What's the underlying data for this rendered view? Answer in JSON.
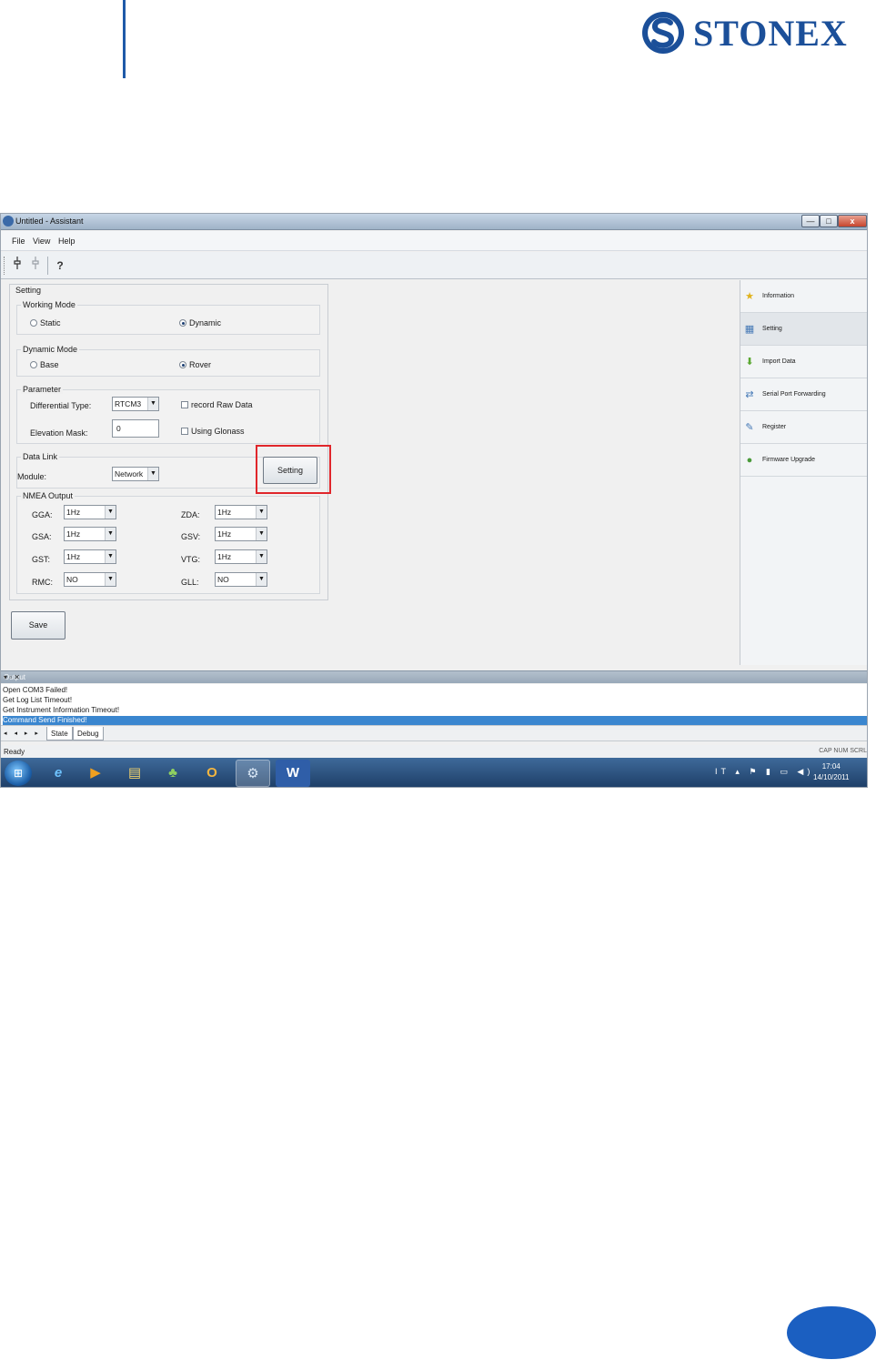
{
  "brand": {
    "name": "STONEX",
    "color": "#1b4f99"
  },
  "window": {
    "title": "Untitled - Assistant",
    "min_label": "—",
    "max_label": "□",
    "close_label": "x"
  },
  "menu": [
    "File",
    "View",
    "Help"
  ],
  "toolbar": {
    "icons": [
      "connect-icon",
      "disconnect-icon",
      "help-icon"
    ],
    "help_glyph": "?"
  },
  "setting": {
    "title": "Setting",
    "working_mode": {
      "label": "Working Mode",
      "options": [
        "Static",
        "Dynamic"
      ],
      "selected": "Dynamic"
    },
    "dynamic_mode": {
      "label": "Dynamic Mode",
      "options": [
        "Base",
        "Rover"
      ],
      "selected": "Rover"
    },
    "parameter": {
      "label": "Parameter",
      "differential_type_label": "Differential Type:",
      "differential_type_value": "RTCM3",
      "elevation_mask_label": "Elevation Mask:",
      "elevation_mask_value": "0",
      "record_raw_data_label": "record Raw Data",
      "using_glonass_label": "Using Glonass"
    },
    "data_link": {
      "label": "Data Link",
      "module_label": "Module:",
      "module_value": "Network",
      "setting_button": "Setting"
    },
    "nmea": {
      "label": "NMEA Output",
      "left": [
        {
          "label": "GGA:",
          "value": "1Hz"
        },
        {
          "label": "GSA:",
          "value": "1Hz"
        },
        {
          "label": "GST:",
          "value": "1Hz"
        },
        {
          "label": "RMC:",
          "value": "NO"
        }
      ],
      "right": [
        {
          "label": "ZDA:",
          "value": "1Hz"
        },
        {
          "label": "GSV:",
          "value": "1Hz"
        },
        {
          "label": "VTG:",
          "value": "1Hz"
        },
        {
          "label": "GLL:",
          "value": "NO"
        }
      ]
    },
    "save_button": "Save"
  },
  "nav": {
    "items": [
      {
        "label": "Information",
        "icon": "star-icon"
      },
      {
        "label": "Setting",
        "icon": "setting-icon"
      },
      {
        "label": "Import Data",
        "icon": "download-arrow-icon"
      },
      {
        "label": "Serial Port Forwarding",
        "icon": "serial-port-icon"
      },
      {
        "label": "Register",
        "icon": "register-icon"
      },
      {
        "label": "Firmware Upgrade",
        "icon": "firmware-icon"
      }
    ],
    "selected": "Setting"
  },
  "output": {
    "title": "Output",
    "controls": "▾ ▫ ✕",
    "lines": [
      "Open COM3 Failed!",
      "Get Log List Timeout!",
      "Get Instrument Information Timeout!",
      "Command Send Finished!"
    ],
    "selected_line": 3,
    "nav_arrows": "◂ ◂ ▸ ▸",
    "tabs": [
      "State",
      "Debug"
    ]
  },
  "statusbar": {
    "text": "Ready",
    "indicators": "CAP  NUM  SCRL"
  },
  "taskbar": {
    "apps": [
      "internet-explorer-icon",
      "media-player-icon",
      "file-explorer-icon",
      "users-icon",
      "outlook-icon",
      "assistant-app-icon",
      "word-icon"
    ],
    "language": "IT",
    "tray_glyphs": "▴ ⚑ ▮ ▭ ◀)",
    "time": "17:04",
    "date": "14/10/2011"
  }
}
